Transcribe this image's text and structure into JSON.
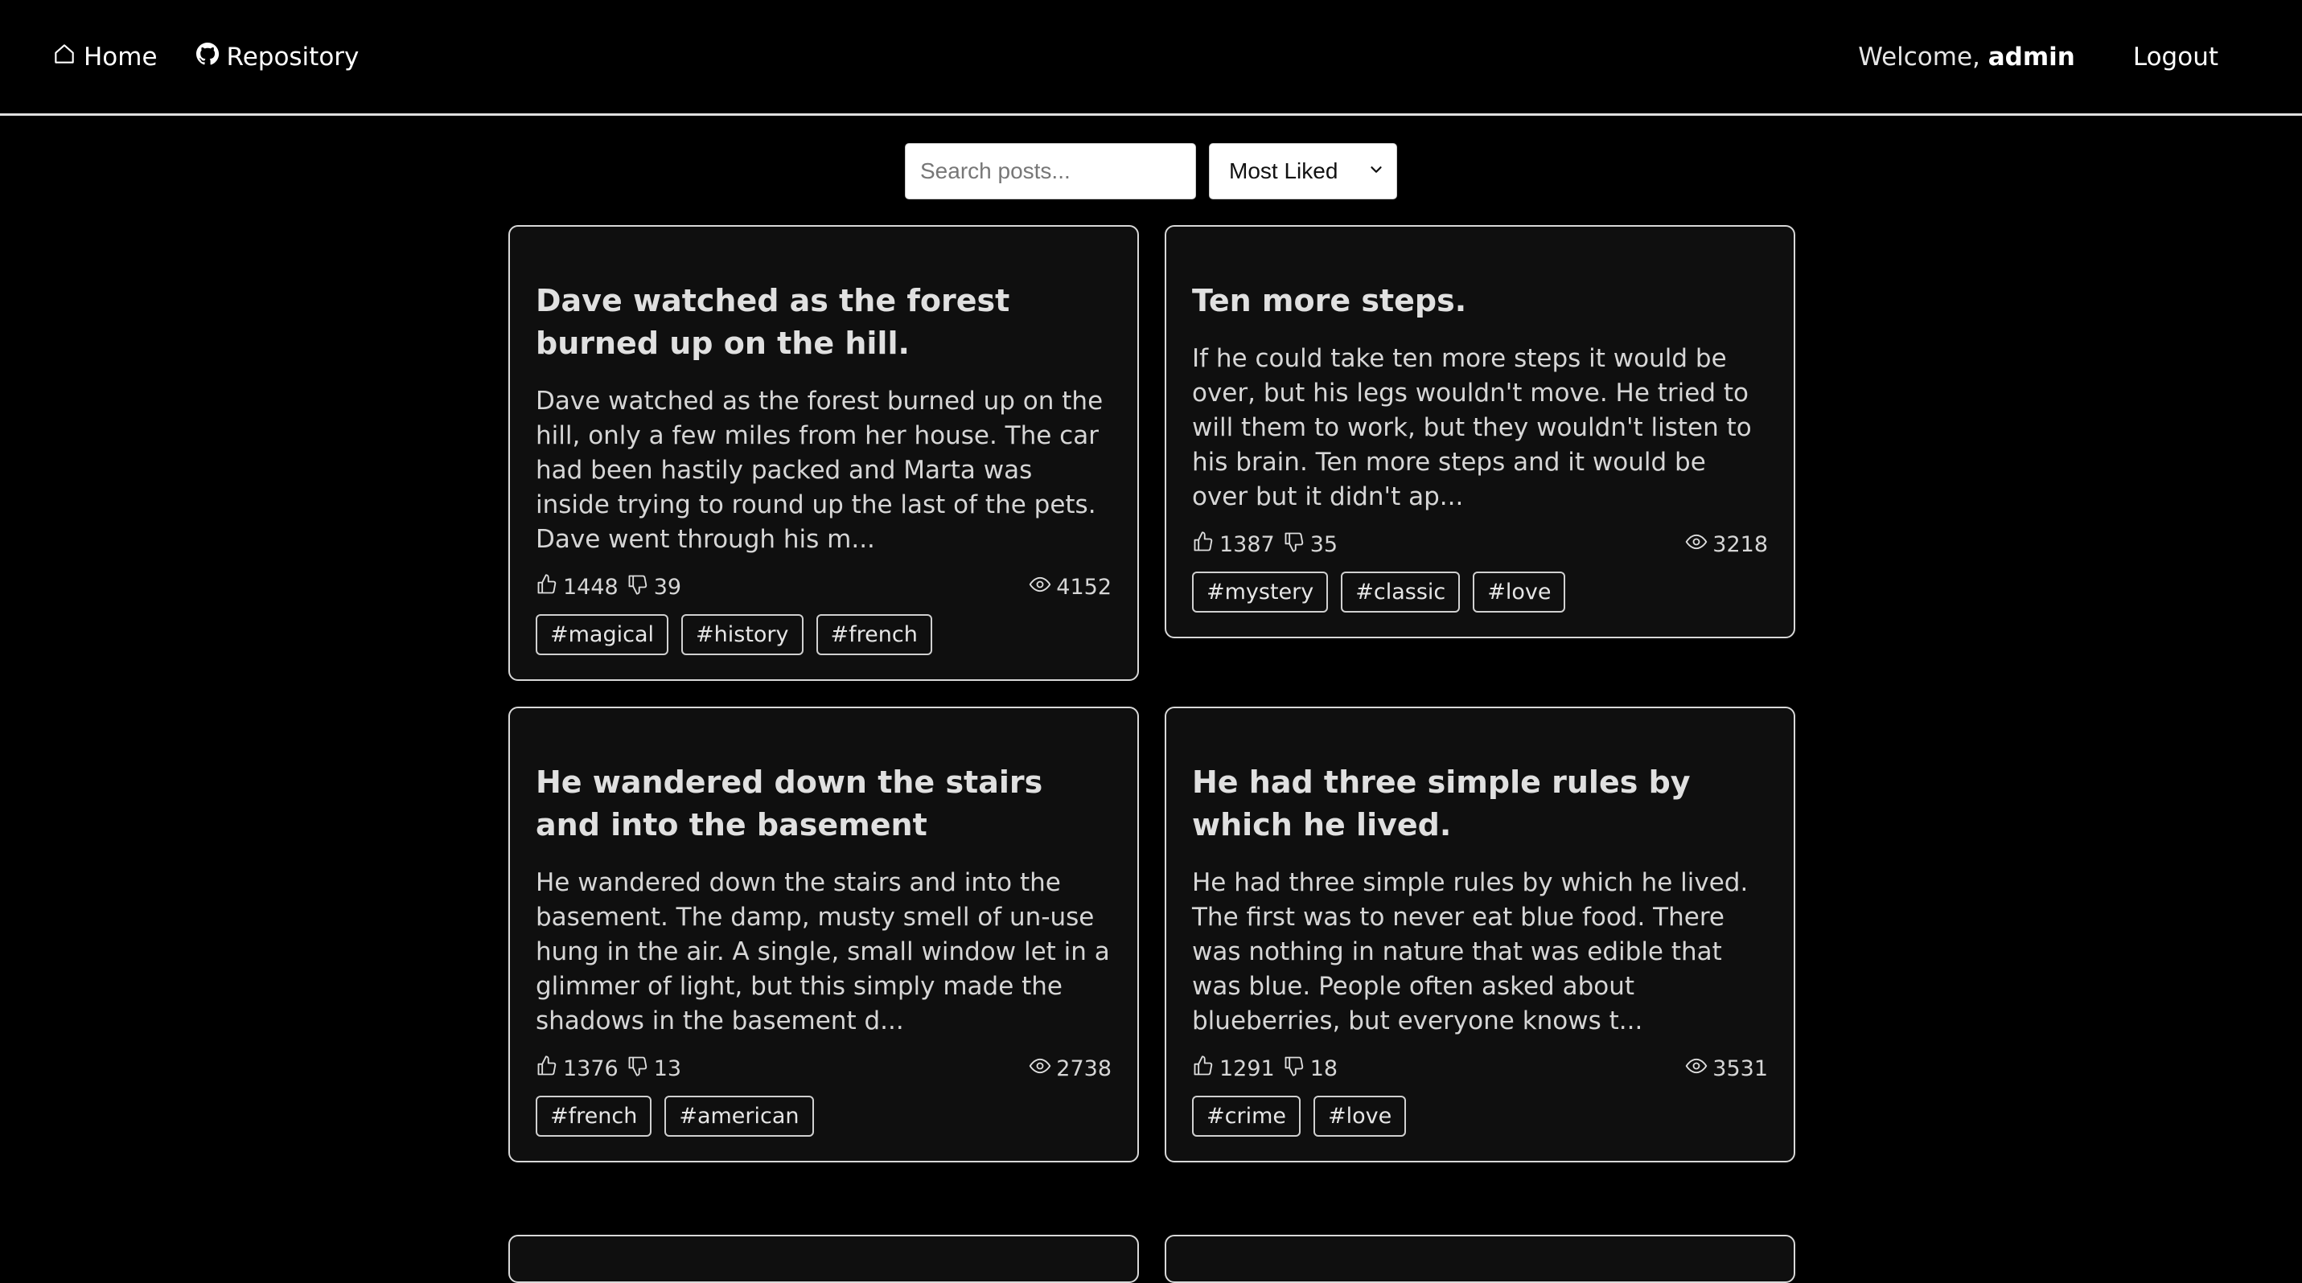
{
  "nav": {
    "home_label": "Home",
    "repo_label": "Repository",
    "welcome_prefix": "Welcome,",
    "username": "admin",
    "logout_label": "Logout"
  },
  "controls": {
    "search_placeholder": "Search posts...",
    "sort_selected": "Most Liked"
  },
  "posts": [
    {
      "title": "Dave watched as the forest burned up on the hill.",
      "body": "Dave watched as the forest burned up on the hill, only a few miles from her house. The car had been hastily packed and Marta was inside trying to round up the last of the pets. Dave went through his m...",
      "likes": "1448",
      "dislikes": "39",
      "views": "4152",
      "tags": [
        "#magical",
        "#history",
        "#french"
      ]
    },
    {
      "title": "Ten more steps.",
      "body": "If he could take ten more steps it would be over, but his legs wouldn't move. He tried to will them to work, but they wouldn't listen to his brain. Ten more steps and it would be over but it didn't ap...",
      "likes": "1387",
      "dislikes": "35",
      "views": "3218",
      "tags": [
        "#mystery",
        "#classic",
        "#love"
      ]
    },
    {
      "title": "He wandered down the stairs and into the basement",
      "body": "He wandered down the stairs and into the basement. The damp, musty smell of un-use hung in the air. A single, small window let in a glimmer of light, but this simply made the shadows in the basement d...",
      "likes": "1376",
      "dislikes": "13",
      "views": "2738",
      "tags": [
        "#french",
        "#american"
      ]
    },
    {
      "title": "He had three simple rules by which he lived.",
      "body": "He had three simple rules by which he lived. The first was to never eat blue food. There was nothing in nature that was edible that was blue. People often asked about blueberries, but everyone knows t...",
      "likes": "1291",
      "dislikes": "18",
      "views": "3531",
      "tags": [
        "#crime",
        "#love"
      ]
    }
  ]
}
